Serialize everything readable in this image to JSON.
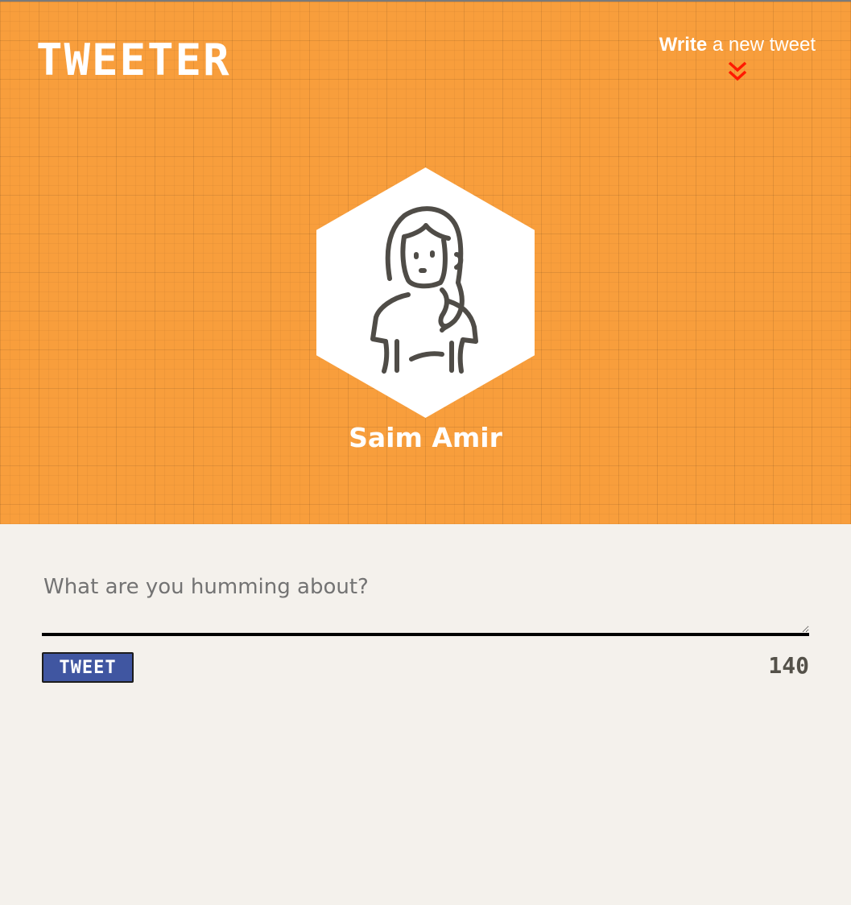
{
  "app": {
    "brand": "TWEETER"
  },
  "nav": {
    "compose_strong": "Write",
    "compose_rest": " a new tweet",
    "compose_icon": "double-chevron-down-icon",
    "compose_icon_color": "#ff1a00"
  },
  "profile": {
    "name": "Saim Amir",
    "avatar_icon": "user-avatar-icon"
  },
  "compose": {
    "placeholder": "What are you humming about?",
    "value": "",
    "submit_label": "TWEET",
    "char_counter": "140"
  },
  "colors": {
    "header_bg": "#f89e3c",
    "page_bg": "#f4f1ec",
    "button_bg": "#4056a1",
    "counter_text": "#545149"
  }
}
